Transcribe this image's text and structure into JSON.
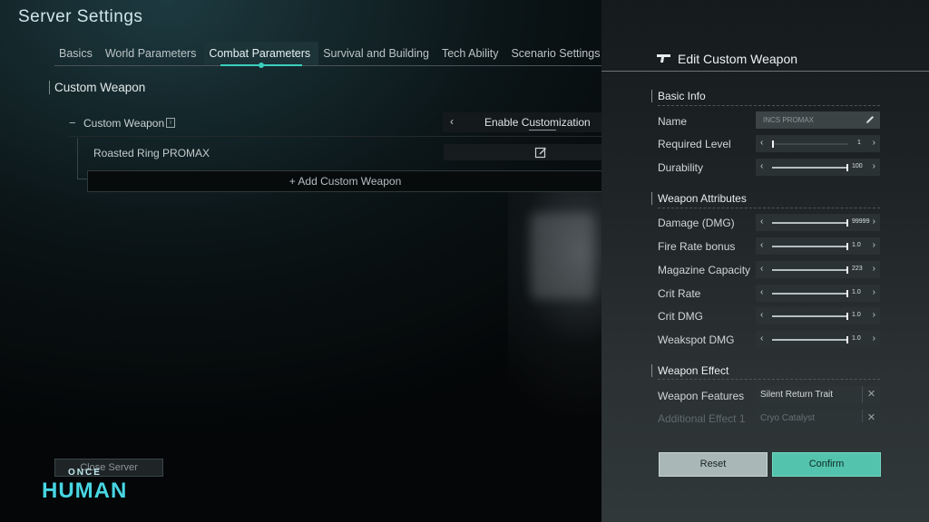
{
  "page": {
    "title": "Server Settings"
  },
  "tabs": [
    {
      "label": "Basics"
    },
    {
      "label": "World Parameters"
    },
    {
      "label": "Combat Parameters",
      "active": true
    },
    {
      "label": "Survival and Building"
    },
    {
      "label": "Tech Ability"
    },
    {
      "label": "Scenario Settings"
    }
  ],
  "main": {
    "section_title": "Custom Weapon",
    "custom_weapon": {
      "label": "Custom Weapon",
      "info_glyph": "i",
      "switch_label": "Enable Customization",
      "switch_arrow": "‹"
    },
    "weapons": [
      {
        "label": "Roasted Ring PROMAX"
      }
    ],
    "add_label": "+ Add Custom Weapon",
    "collapse_glyph": "−"
  },
  "footer": {
    "close_server": "Close Server",
    "logo_small": "ONCE",
    "logo_main": "HUMAN"
  },
  "panel": {
    "title": "Edit Custom Weapon",
    "basic_info": {
      "heading": "Basic Info",
      "name_label": "Name",
      "name_value": "INCS PROMAX",
      "required_level_label": "Required Level",
      "required_level_value": "1",
      "durability_label": "Durability",
      "durability_value": "100"
    },
    "attributes": {
      "heading": "Weapon Attributes",
      "items": [
        {
          "label": "Damage (DMG)",
          "value": "99999"
        },
        {
          "label": "Fire Rate bonus",
          "value": "1.0"
        },
        {
          "label": "Magazine Capacity",
          "value": "223"
        },
        {
          "label": "Crit Rate",
          "value": "1.0"
        },
        {
          "label": "Crit DMG",
          "value": "1.0"
        },
        {
          "label": "Weakspot DMG",
          "value": "1.0"
        }
      ]
    },
    "effect": {
      "heading": "Weapon Effect",
      "features_label": "Weapon Features",
      "features_value": "Silent Return Trait",
      "additional_label": "Additional Effect 1",
      "additional_value": "Cryo Catalyst"
    },
    "buttons": {
      "reset": "Reset",
      "confirm": "Confirm"
    },
    "arrows": {
      "left": "‹",
      "right": "›"
    }
  },
  "colors": {
    "accent": "#3ad0bd",
    "confirm": "#53c3ad",
    "logo": "#47d6e2"
  }
}
